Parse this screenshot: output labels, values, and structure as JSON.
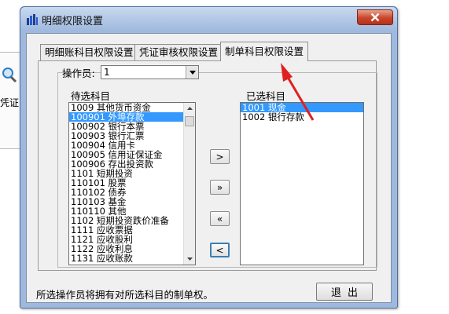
{
  "background_app": {
    "partial_label": "凭证"
  },
  "window": {
    "title": "明细权限设置"
  },
  "tabs": [
    {
      "label": "明细账科目权限设置"
    },
    {
      "label": "凭证审核权限设置"
    },
    {
      "label": "制单科目权限设置"
    }
  ],
  "operator": {
    "label": "操作员:",
    "value": "1"
  },
  "available": {
    "label": "待选科目",
    "items": [
      "1009 其他货币资金",
      "100901 外埠存款",
      "100902 银行本票",
      "100903 银行汇票",
      "100904 信用卡",
      "100905 信用证保证金",
      "100906 存出投资款",
      "1101 短期投资",
      "110101 股票",
      "110102 债券",
      "110103 基金",
      "110110 其他",
      "1102 短期投资跌价准备",
      "1111 应收票据",
      "1121 应收股利",
      "1122 应收利息",
      "1131 应收账款"
    ],
    "selected_index": 1
  },
  "selected": {
    "label": "已选科目",
    "items": [
      "1001 现金",
      "1002 银行存款"
    ],
    "selected_index": 0
  },
  "buttons": {
    "add_one": ">",
    "add_all": "»",
    "remove_all": "«",
    "remove_one": "<",
    "exit": "退出"
  },
  "hint": "所选操作员将拥有对所选科目的制单权。",
  "colors": {
    "selection": "#3399ff",
    "annotation_arrow": "#e02020",
    "close_button": "#c9452a"
  }
}
